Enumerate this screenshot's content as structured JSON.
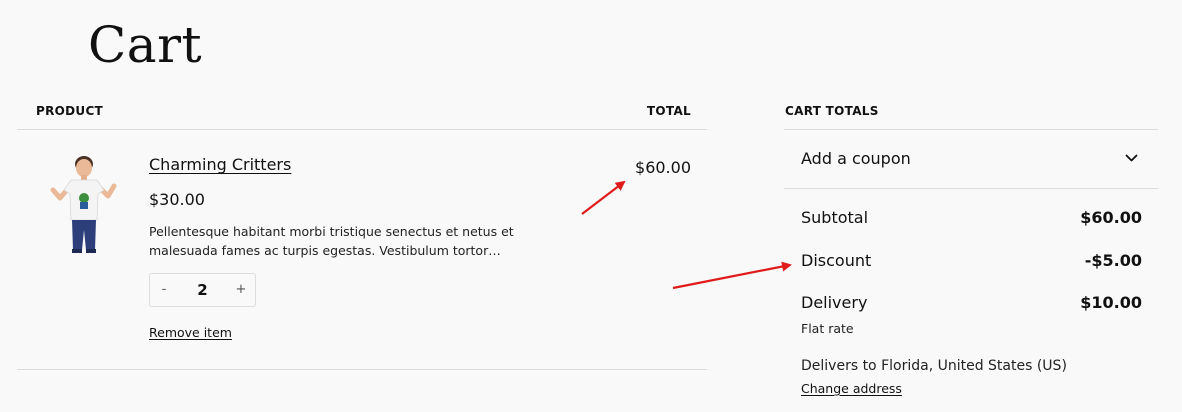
{
  "page": {
    "title": "Cart"
  },
  "cart_table": {
    "product_header": "PRODUCT",
    "total_header": "TOTAL",
    "items": [
      {
        "name": "Charming Critters",
        "price": "$30.00",
        "description": "Pellentesque habitant morbi tristique senectus et netus et malesuada fames ac turpis egestas. Vestibulum tortor…",
        "quantity": "2",
        "qty_minus": "-",
        "qty_plus": "+",
        "remove_label": "Remove item",
        "line_total": "$60.00",
        "image_icon": "boy-tshirt-product-photo"
      }
    ]
  },
  "cart_totals": {
    "heading": "CART TOTALS",
    "coupon_label": "Add a coupon",
    "coupon_icon": "chevron-down-icon",
    "subtotal_label": "Subtotal",
    "subtotal_value": "$60.00",
    "discount_label": "Discount",
    "discount_value": "-$5.00",
    "delivery_label": "Delivery",
    "delivery_value": "$10.00",
    "delivery_method": "Flat rate",
    "delivers_to": "Delivers to Florida, United States (US)",
    "change_address_label": "Change address"
  },
  "colors": {
    "background": "#f9f9f9",
    "text": "#111111",
    "divider": "#dcdcdc",
    "annotation_arrow": "#e01b1b"
  }
}
